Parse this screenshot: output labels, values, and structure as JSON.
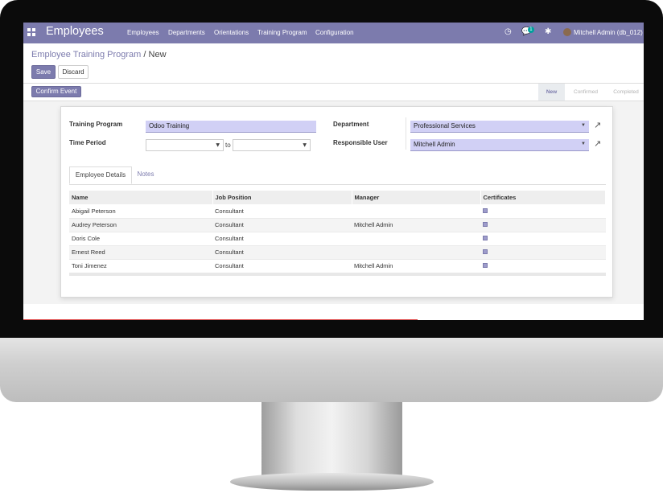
{
  "navbar": {
    "app_title": "Employees",
    "menu": [
      "Employees",
      "Departments",
      "Orientations",
      "Training Program",
      "Configuration"
    ],
    "message_count": "1",
    "user_label": "Mitchell Admin (db_012)"
  },
  "breadcrumb": {
    "parent": "Employee Training Program",
    "separator": "/",
    "current": "New"
  },
  "buttons": {
    "save": "Save",
    "discard": "Discard",
    "confirm_event": "Confirm Event"
  },
  "stages": [
    "New",
    "Confirmed",
    "Completed"
  ],
  "form": {
    "training_program_label": "Training Program",
    "training_program_value": "Odoo Training",
    "time_period_label": "Time Period",
    "time_period_to": "to",
    "department_label": "Department",
    "department_value": "Professional Services",
    "responsible_user_label": "Responsible User",
    "responsible_user_value": "Mitchell Admin"
  },
  "tabs": [
    "Employee Details",
    "Notes"
  ],
  "table": {
    "columns": [
      "Name",
      "Job Position",
      "Manager",
      "Certificates"
    ],
    "rows": [
      {
        "name": "Abigail Peterson",
        "job": "Consultant",
        "manager": ""
      },
      {
        "name": "Audrey Peterson",
        "job": "Consultant",
        "manager": "Mitchell Admin"
      },
      {
        "name": "Doris Cole",
        "job": "Consultant",
        "manager": ""
      },
      {
        "name": "Ernest Reed",
        "job": "Consultant",
        "manager": ""
      },
      {
        "name": "Toni Jimenez",
        "job": "Consultant",
        "manager": "Mitchell Admin"
      }
    ]
  },
  "colors": {
    "brand": "#7c7bad",
    "input_highlight": "#d1d0f5"
  }
}
